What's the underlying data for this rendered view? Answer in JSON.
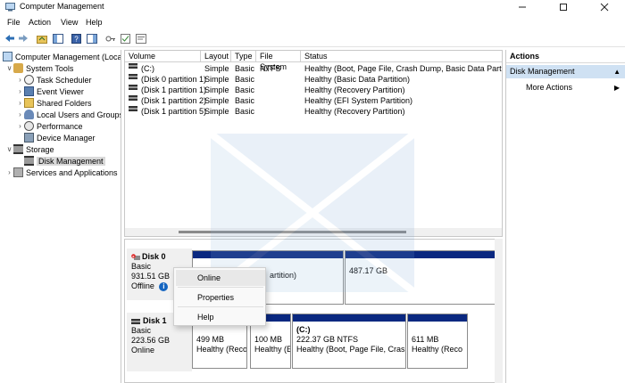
{
  "window": {
    "title": "Computer Management",
    "icon": "computer-management-icon"
  },
  "menu": [
    "File",
    "Action",
    "View",
    "Help"
  ],
  "tree": {
    "root": "Computer Management (Local",
    "system_tools": "System Tools",
    "task_scheduler": "Task Scheduler",
    "event_viewer": "Event Viewer",
    "shared_folders": "Shared Folders",
    "local_users": "Local Users and Groups",
    "performance": "Performance",
    "device_manager": "Device Manager",
    "storage": "Storage",
    "disk_management": "Disk Management",
    "services": "Services and Applications"
  },
  "volumes": {
    "columns": [
      "Volume",
      "Layout",
      "Type",
      "File System",
      "Status"
    ],
    "rows": [
      {
        "volume": "(C:)",
        "layout": "Simple",
        "type": "Basic",
        "fs": "NTFS",
        "status": "Healthy (Boot, Page File, Crash Dump, Basic Data Partition)"
      },
      {
        "volume": "(Disk 0 partition 1)",
        "layout": "Simple",
        "type": "Basic",
        "fs": "",
        "status": "Healthy (Basic Data Partition)"
      },
      {
        "volume": "(Disk 1 partition 1)",
        "layout": "Simple",
        "type": "Basic",
        "fs": "",
        "status": "Healthy (Recovery Partition)"
      },
      {
        "volume": "(Disk 1 partition 2)",
        "layout": "Simple",
        "type": "Basic",
        "fs": "",
        "status": "Healthy (EFI System Partition)"
      },
      {
        "volume": "(Disk 1 partition 5)",
        "layout": "Simple",
        "type": "Basic",
        "fs": "",
        "status": "Healthy (Recovery Partition)"
      }
    ]
  },
  "disk0": {
    "name": "Disk 0",
    "type": "Basic",
    "size": "931.51 GB",
    "state": "Offline",
    "partitions": [
      {
        "line1": "",
        "line2": "artition)"
      },
      {
        "line1": "487.17 GB",
        "line2": ""
      }
    ]
  },
  "disk1": {
    "name": "Disk 1",
    "type": "Basic",
    "size": "223.56 GB",
    "state": "Online",
    "partitions": [
      {
        "line1": "499 MB",
        "line2": "Healthy (Reco"
      },
      {
        "line1": "100 MB",
        "line2": "Healthy (E"
      },
      {
        "line1": "(C:)",
        "line2": "222.37 GB NTFS",
        "line3": "Healthy (Boot, Page File, Crash"
      },
      {
        "line1": "611 MB",
        "line2": "Healthy (Reco"
      }
    ]
  },
  "context_menu": {
    "items": [
      "Online",
      "Properties",
      "Help"
    ],
    "hovered": "Online"
  },
  "actions": {
    "title": "Actions",
    "section": "Disk Management",
    "more": "More Actions"
  },
  "colors": {
    "partition_band": "#0a2880",
    "selection": "#cfe1f3",
    "info": "#1565c0"
  }
}
